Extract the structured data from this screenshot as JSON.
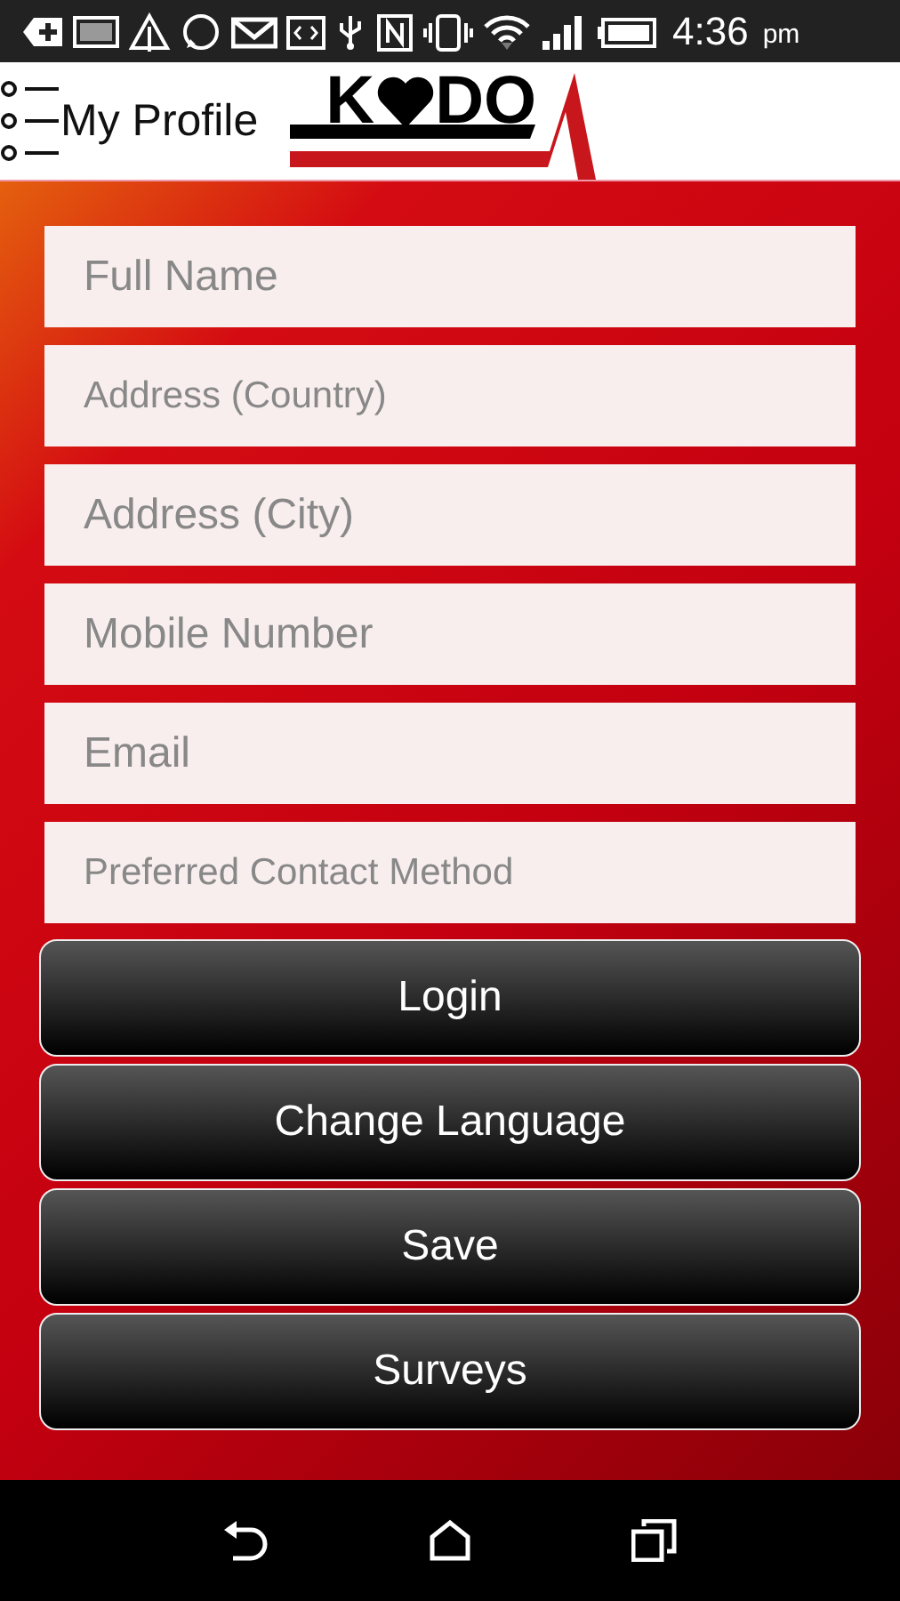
{
  "status_bar": {
    "time": "4:36",
    "meridiem": "pm"
  },
  "header": {
    "title": "My Profile",
    "logo": {
      "before": "K",
      "after": "DO"
    }
  },
  "form": {
    "fields": [
      {
        "placeholder": "Full Name"
      },
      {
        "placeholder": "Address (Country)"
      },
      {
        "placeholder": "Address (City)"
      },
      {
        "placeholder": "Mobile Number"
      },
      {
        "placeholder": "Email"
      },
      {
        "placeholder": "Preferred Contact Method"
      }
    ],
    "buttons": [
      {
        "label": "Login"
      },
      {
        "label": "Change Language"
      },
      {
        "label": "Save"
      },
      {
        "label": "Surveys"
      }
    ]
  }
}
